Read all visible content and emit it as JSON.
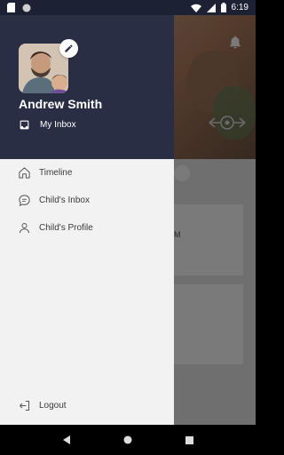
{
  "status_bar": {
    "time": "6:19"
  },
  "drawer": {
    "user": {
      "name": "Andrew Smith"
    },
    "inbox_label": "My Inbox",
    "menu_items": [
      {
        "label": "Timeline",
        "icon": "home-icon"
      },
      {
        "label": "Child's Inbox",
        "icon": "chat-bubble-icon"
      },
      {
        "label": "Child's Profile",
        "icon": "person-icon"
      }
    ],
    "logout_label": "Logout"
  },
  "background": {
    "partial_text": "M"
  },
  "colors": {
    "drawer_header": "#2a2e45",
    "drawer_body": "#f2f2f2",
    "menu_text": "#3a3a3a"
  }
}
